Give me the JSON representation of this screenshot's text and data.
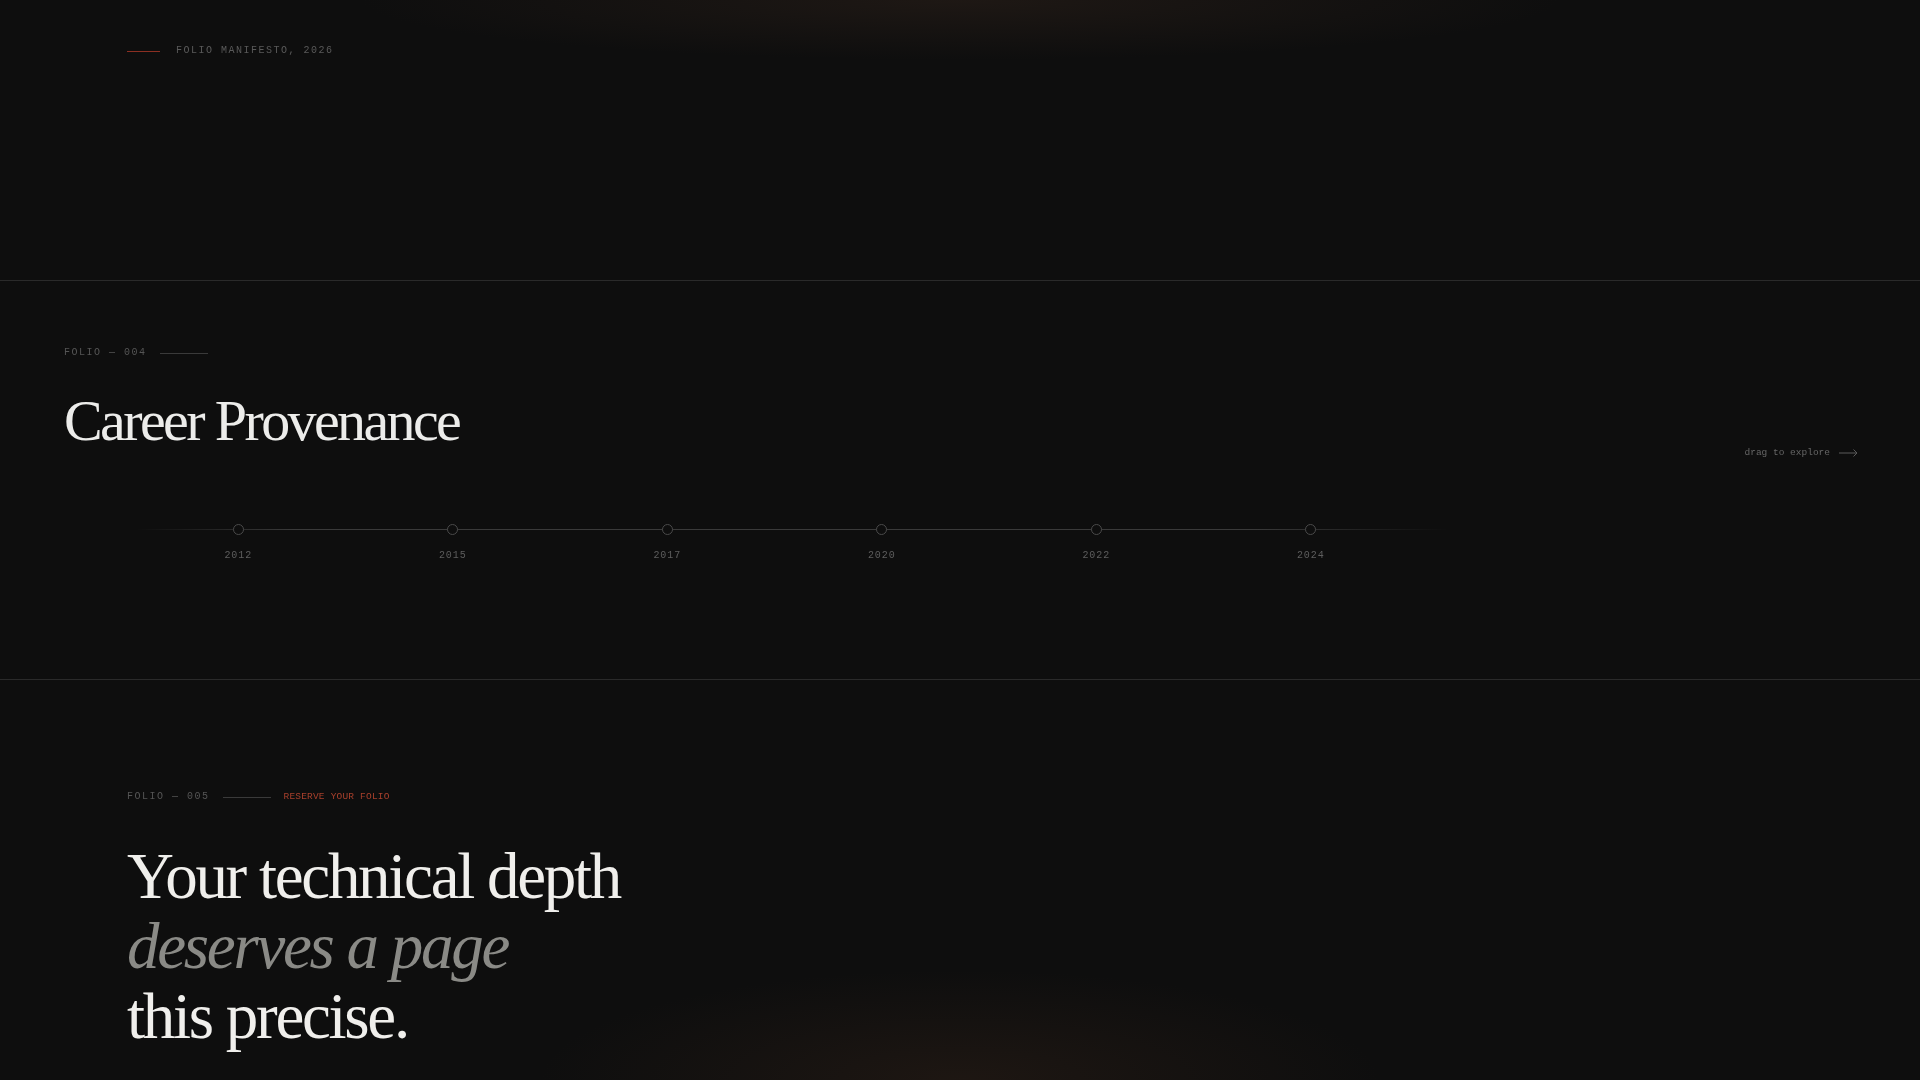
{
  "manifesto": {
    "label": "FOLIO MANIFESTO, 2026"
  },
  "career": {
    "folio": "FOLIO — 004",
    "title": "Career Provenance",
    "hint": "drag to explore",
    "timeline": [
      {
        "year": "2012"
      },
      {
        "year": "2015"
      },
      {
        "year": "2017"
      },
      {
        "year": "2020"
      },
      {
        "year": "2022"
      },
      {
        "year": "2024"
      }
    ]
  },
  "reserve": {
    "folio": "FOLIO — 005",
    "tag": "RESERVE YOUR FOLIO",
    "headline": "Your technical depth *deserves a page* this precise."
  }
}
